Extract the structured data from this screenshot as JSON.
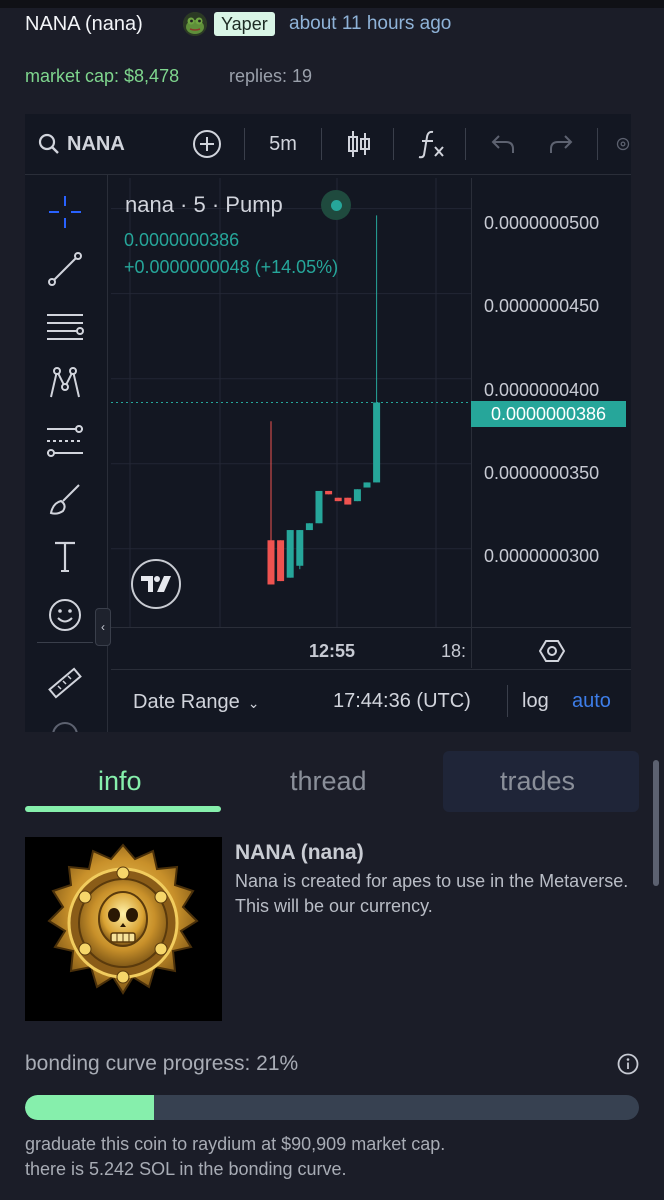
{
  "header": {
    "title": "NANA (nana)",
    "user_badge": "Yaper",
    "time_ago": "about 11 hours ago",
    "market_cap": "market cap: $8,478",
    "replies": "replies: 19"
  },
  "chart_toolbar": {
    "symbol": "NANA",
    "interval": "5m"
  },
  "chart_legend": {
    "title": "nana · 5 · Pump",
    "price": "0.0000000386",
    "change": "+0.0000000048 (+14.05%)"
  },
  "chart_data": {
    "type": "candlestick",
    "y_ticks": [
      "0.0000000500",
      "0.0000000450",
      "0.0000000400",
      "0.0000000350",
      "0.0000000300"
    ],
    "ylim": [
      2.54e-08,
      5.18e-08
    ],
    "current_price_label": "0.0000000386",
    "x_ticks": [
      "12:55",
      "18:"
    ],
    "candles": [
      {
        "open": 3.05e-08,
        "high": 3.75e-08,
        "low": 2.79e-08,
        "close": 2.79e-08
      },
      {
        "open": 3.05e-08,
        "high": 3.05e-08,
        "low": 2.81e-08,
        "close": 2.81e-08
      },
      {
        "open": 2.83e-08,
        "high": 3.11e-08,
        "low": 2.83e-08,
        "close": 3.11e-08
      },
      {
        "open": 2.9e-08,
        "high": 3.11e-08,
        "low": 2.88e-08,
        "close": 3.11e-08
      },
      {
        "open": 3.11e-08,
        "high": 3.15e-08,
        "low": 3.11e-08,
        "close": 3.15e-08
      },
      {
        "open": 3.15e-08,
        "high": 3.34e-08,
        "low": 3.15e-08,
        "close": 3.34e-08
      },
      {
        "open": 3.34e-08,
        "high": 3.34e-08,
        "low": 3.32e-08,
        "close": 3.32e-08
      },
      {
        "open": 3.3e-08,
        "high": 3.3e-08,
        "low": 3.28e-08,
        "close": 3.28e-08
      },
      {
        "open": 3.3e-08,
        "high": 3.3e-08,
        "low": 3.26e-08,
        "close": 3.26e-08
      },
      {
        "open": 3.28e-08,
        "high": 3.35e-08,
        "low": 3.28e-08,
        "close": 3.35e-08
      },
      {
        "open": 3.36e-08,
        "high": 3.39e-08,
        "low": 3.36e-08,
        "close": 3.39e-08
      },
      {
        "open": 3.39e-08,
        "high": 4.96e-08,
        "low": 3.39e-08,
        "close": 3.86e-08
      }
    ]
  },
  "chart_bottom": {
    "date_range": "Date Range",
    "time": "17:44:36 (UTC)",
    "log": "log",
    "auto": "auto"
  },
  "tabs": [
    {
      "label": "info"
    },
    {
      "label": "thread"
    },
    {
      "label": "trades"
    }
  ],
  "coin": {
    "name": "NANA (nana)",
    "description": "Nana is created for apes to use in the Metaverse. This will be our currency."
  },
  "bonding_curve": {
    "label": "bonding curve progress: 21%",
    "progress": 0.21,
    "graduate_text": "graduate this coin to raydium at $90,909 market cap.",
    "sol_text": "there is 5.242 SOL in the bonding curve."
  },
  "colors": {
    "accent_green": "#86efac",
    "candle_up": "#26a69a",
    "candle_down": "#ef5350",
    "link_blue": "#3d7de8"
  }
}
